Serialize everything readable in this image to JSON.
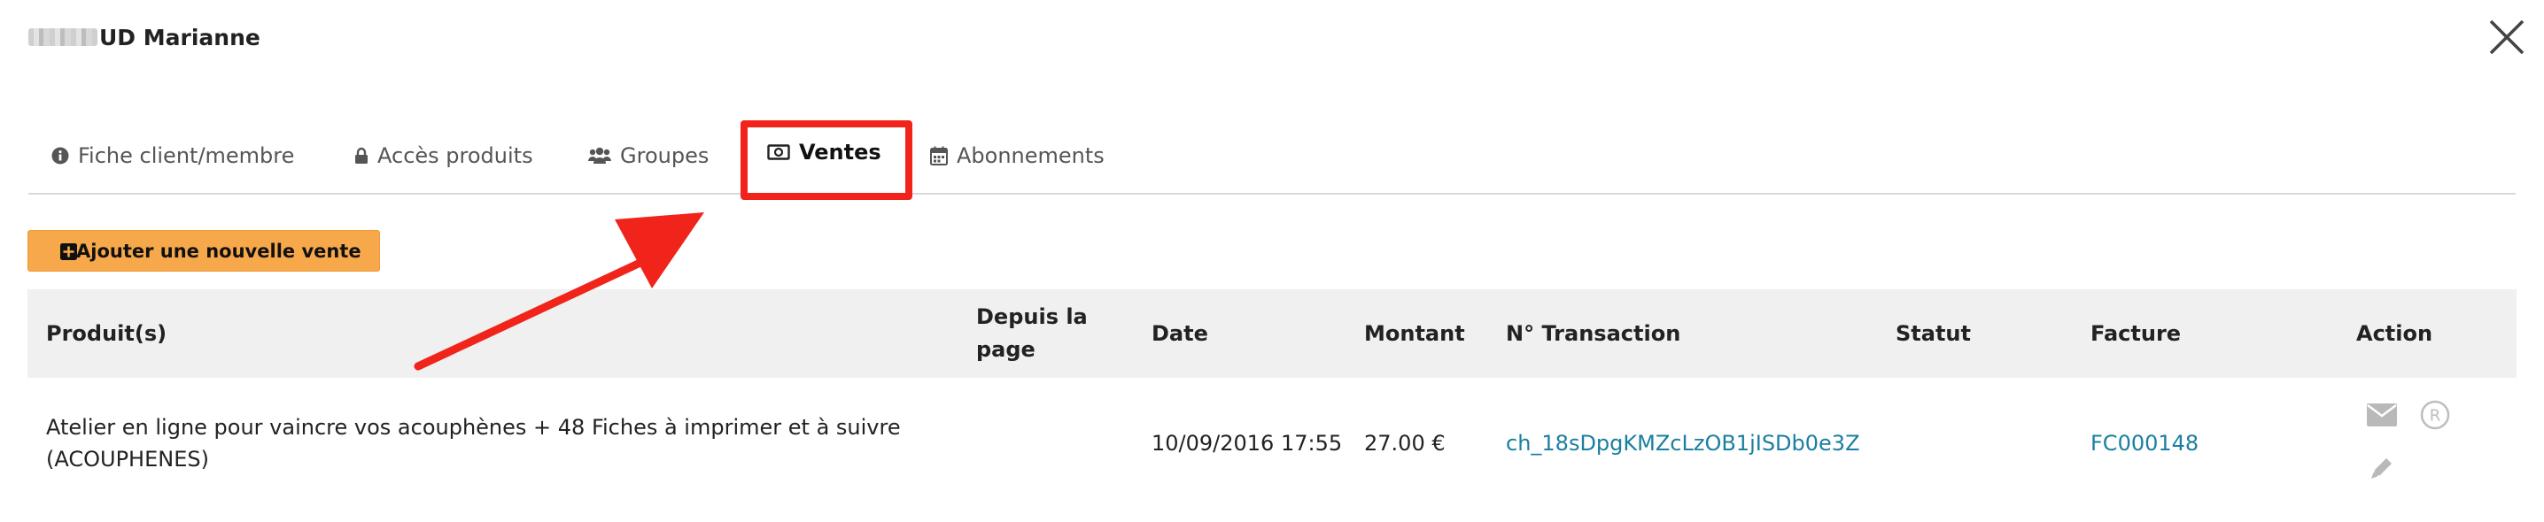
{
  "modal": {
    "title": "UD Marianne"
  },
  "tabs": [
    {
      "label": "Fiche client/membre",
      "icon": "info-circle-icon"
    },
    {
      "label": "Accès produits",
      "icon": "lock-icon"
    },
    {
      "label": "Groupes",
      "icon": "users-icon"
    },
    {
      "label": "Ventes",
      "icon": "money-bill-icon",
      "active": true
    },
    {
      "label": "Abonnements",
      "icon": "calendar-icon"
    }
  ],
  "add_button": {
    "label": "Ajouter une nouvelle vente",
    "icon": "plus-square-icon"
  },
  "table": {
    "headers": {
      "product": "Produit(s)",
      "from_page_line1": "Depuis la",
      "from_page_line2": "page",
      "date": "Date",
      "amount": "Montant",
      "transaction": "N° Transaction",
      "status": "Statut",
      "invoice": "Facture",
      "action": "Action"
    },
    "rows": [
      {
        "product_line1": "Atelier en ligne pour vaincre vos acouphènes + 48 Fiches à imprimer et à suivre",
        "product_line2": "(ACOUPHENES)",
        "from_page": "",
        "date": "10/09/2016 17:55",
        "amount": "27.00 €",
        "transaction": "ch_18sDpgKMZcLzOB1jISDb0e3Z",
        "status": "",
        "invoice": "FC000148",
        "actions": [
          "envelope-icon",
          "registered-icon",
          "pencil-icon"
        ]
      }
    ]
  },
  "colors": {
    "accent": "#f7a84a",
    "link": "#1a7fa0",
    "highlight": "#f0241b"
  }
}
